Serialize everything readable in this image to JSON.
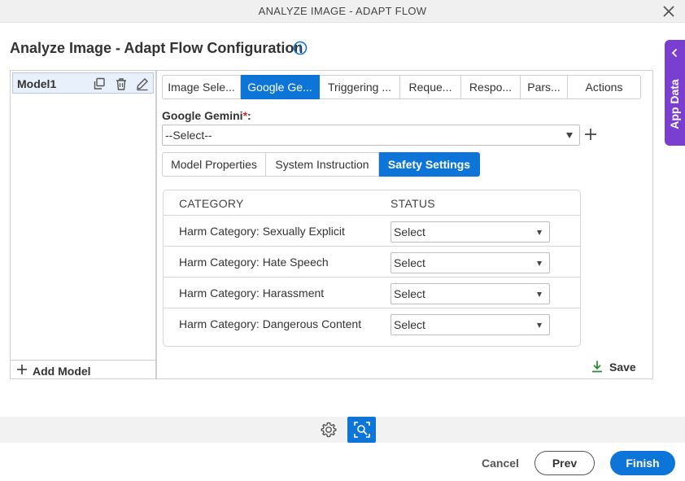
{
  "window": {
    "title": "ANALYZE IMAGE - ADAPT FLOW"
  },
  "page": {
    "heading": "Analyze Image - Adapt Flow Configuration"
  },
  "app_data": {
    "label": "App Data"
  },
  "models": {
    "items": [
      {
        "name": "Model1"
      }
    ],
    "add_label": "Add Model"
  },
  "tabs": [
    {
      "label": "Image Sele...",
      "active": false
    },
    {
      "label": "Google Ge...",
      "active": true
    },
    {
      "label": "Triggering ...",
      "active": false
    },
    {
      "label": "Reque...",
      "active": false
    },
    {
      "label": "Respo...",
      "active": false
    },
    {
      "label": "Pars...",
      "active": false
    },
    {
      "label": "Actions",
      "active": false
    }
  ],
  "gemini": {
    "label": "Google Gemini",
    "required_mark": "*",
    "colon": ":",
    "value": "--Select--"
  },
  "subtabs": [
    {
      "label": "Model Properties",
      "active": false
    },
    {
      "label": "System Instruction",
      "active": false
    },
    {
      "label": "Safety Settings",
      "active": true
    }
  ],
  "safety": {
    "headers": {
      "category": "CATEGORY",
      "status": "STATUS"
    },
    "rows": [
      {
        "category": "Harm Category: Sexually Explicit",
        "status": "Select"
      },
      {
        "category": "Harm Category: Hate Speech",
        "status": "Select"
      },
      {
        "category": "Harm Category: Harassment",
        "status": "Select"
      },
      {
        "category": "Harm Category: Dangerous Content",
        "status": "Select"
      }
    ],
    "save_label": "Save"
  },
  "footer": {
    "cancel": "Cancel",
    "prev": "Prev",
    "finish": "Finish"
  },
  "colors": {
    "accent": "#0d75d8",
    "app_data": "#7a3fd0",
    "required": "#e0221b",
    "save_icon": "#2e8b3a"
  }
}
